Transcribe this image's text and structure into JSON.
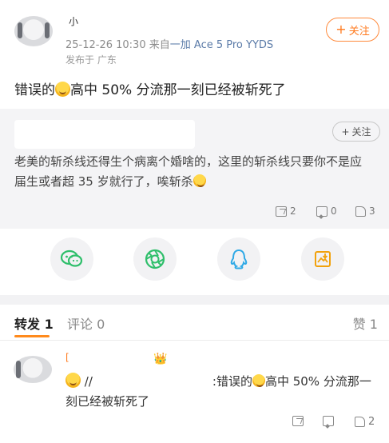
{
  "post": {
    "username_fragment": "小",
    "timestamp": "25-12-26 10:30",
    "source_prefix": "来自",
    "device": "一加 Ace 5 Pro YYDS",
    "location": "发布于 广东",
    "follow_label": "关注",
    "text_before_emoji": "错误的",
    "text_after_emoji": "高中 50% 分流那一刻已经被斩死了"
  },
  "quoted": {
    "follow_label": "关注",
    "text": "老美的斩杀线还得生个病离个婚啥的，这里的斩杀线只要你不是应届生或者超 35 岁就行了，唉斩杀",
    "reposts": "2",
    "comments": "0",
    "likes": "3"
  },
  "share": {
    "icons": [
      "wechat-icon",
      "moments-icon",
      "qq-icon",
      "save-image-icon"
    ]
  },
  "tabs": {
    "repost": "转发 1",
    "comment": "评论 0",
    "like": "赞 1"
  },
  "repost_item": {
    "username_fragment": "[",
    "text_prefix": "//",
    "text_middle": ":错误的",
    "text_after_emoji": "高中 50% 分流那一刻已经被斩死了",
    "likes": "2"
  },
  "colors": {
    "accent": "#ff7a1e",
    "device_link": "#5b7ba8",
    "muted": "#8c8c8c",
    "card_bg": "#f4f4f6"
  }
}
